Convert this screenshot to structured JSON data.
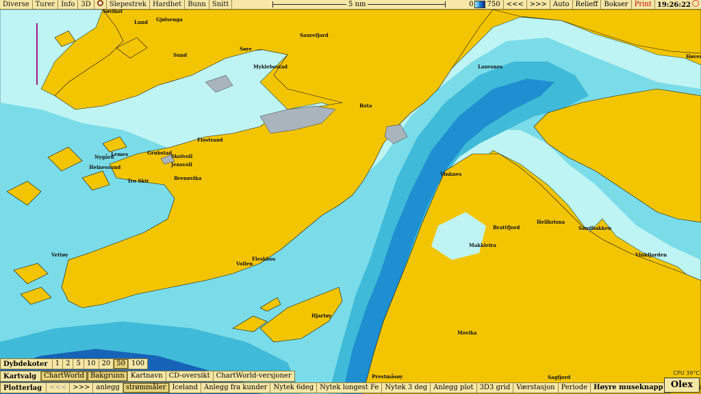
{
  "toolbar": {
    "menu": [
      "Diverse",
      "Turer",
      "Info",
      "3D"
    ],
    "actions": [
      "Slepestrek",
      "Hardhet",
      "Bunn",
      "Snitt"
    ],
    "scale_label": "5 nm",
    "depth_min": "0",
    "depth_max": "750",
    "nav_back": "<<<",
    "nav_fwd": ">>>",
    "right_buttons": [
      "Auto",
      "Relieff",
      "Bokser"
    ],
    "print": "Print",
    "clock": "19:26:22"
  },
  "dybdekoter": {
    "title": "Dybdekoter",
    "values": [
      "1",
      "2",
      "5",
      "10",
      "20",
      "50",
      "100"
    ],
    "selected": "50"
  },
  "kartvalg": {
    "title": "Kartvalg",
    "buttons": [
      "ChartWorld",
      "Bakgrunn",
      "Kartnavn",
      "CD-oversikt",
      "ChartWorld-versjoner"
    ]
  },
  "plotterlag": {
    "title": "Plotterlag",
    "buttons": [
      "<<<",
      ">>>",
      "anlegg",
      "strømmåler",
      "Iceland",
      "Anlegg fra kunder",
      "Nytek 6deg",
      "Nytek longest Fe",
      "Nytek 3 deg",
      "Anlegg plot",
      "3D3 grid",
      "Værstasjon",
      "Periode",
      "Høyre museknapp endrer navn"
    ]
  },
  "status": {
    "cpu": "CPU 39°C",
    "brand": "Olex"
  },
  "map": {
    "colors": {
      "land": "#f3c500",
      "shallow": "#bff4f4",
      "mid": "#7adce8",
      "deep": "#3fbad8",
      "deeper": "#1e8fd0",
      "deepest": "#1763b8"
    },
    "places": [
      "Søvikot",
      "Lund",
      "Gjølsenga",
      "Sund",
      "Søre",
      "Saurefjord",
      "Myklebostad",
      "Bota",
      "Lauvsnes",
      "Høven",
      "Grubstad",
      "Nygård",
      "Lemes",
      "Helnessund",
      "Skolvoll",
      "Jensvoll",
      "Flostrand",
      "Tro Skir",
      "Brennvika",
      "Vinknes",
      "Brattfjord",
      "Hellkrisna",
      "Sandbakken",
      "Vinkfjorden",
      "Makkleira",
      "Hjartøy",
      "Vollen",
      "Fleskbos",
      "Vettøy",
      "Movika",
      "Prestmåsøy",
      "Sagfjord"
    ]
  }
}
